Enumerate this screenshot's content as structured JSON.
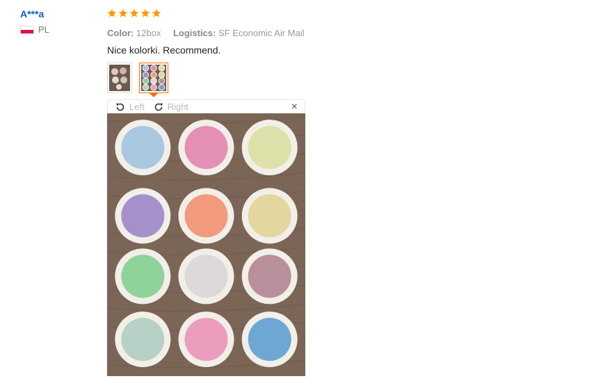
{
  "reviewer": {
    "name": "A***a",
    "country": "PL",
    "flag_colors": [
      "#ffffff",
      "#dc143c"
    ]
  },
  "review": {
    "rating": 5,
    "star_color": "#ff9900",
    "color_label": "Color:",
    "color_value": "12box",
    "logistics_label": "Logistics:",
    "logistics_value": "SF Economic Air Mail",
    "text": "Nice kolorki. Recommend.",
    "thumbnails": [
      {
        "active": false
      },
      {
        "active": true
      }
    ]
  },
  "viewer": {
    "rotate_left_label": "Left",
    "rotate_right_label": "Right",
    "close_label": "×",
    "pigments": [
      "#a9c8df",
      "#e48fb4",
      "#dde0a8",
      "#a690cc",
      "#f29a7d",
      "#e3d79f",
      "#8fd29a",
      "#ddd9da",
      "#b98f9b",
      "#b7d1c6",
      "#ec9dbd",
      "#6ea7d3"
    ]
  }
}
